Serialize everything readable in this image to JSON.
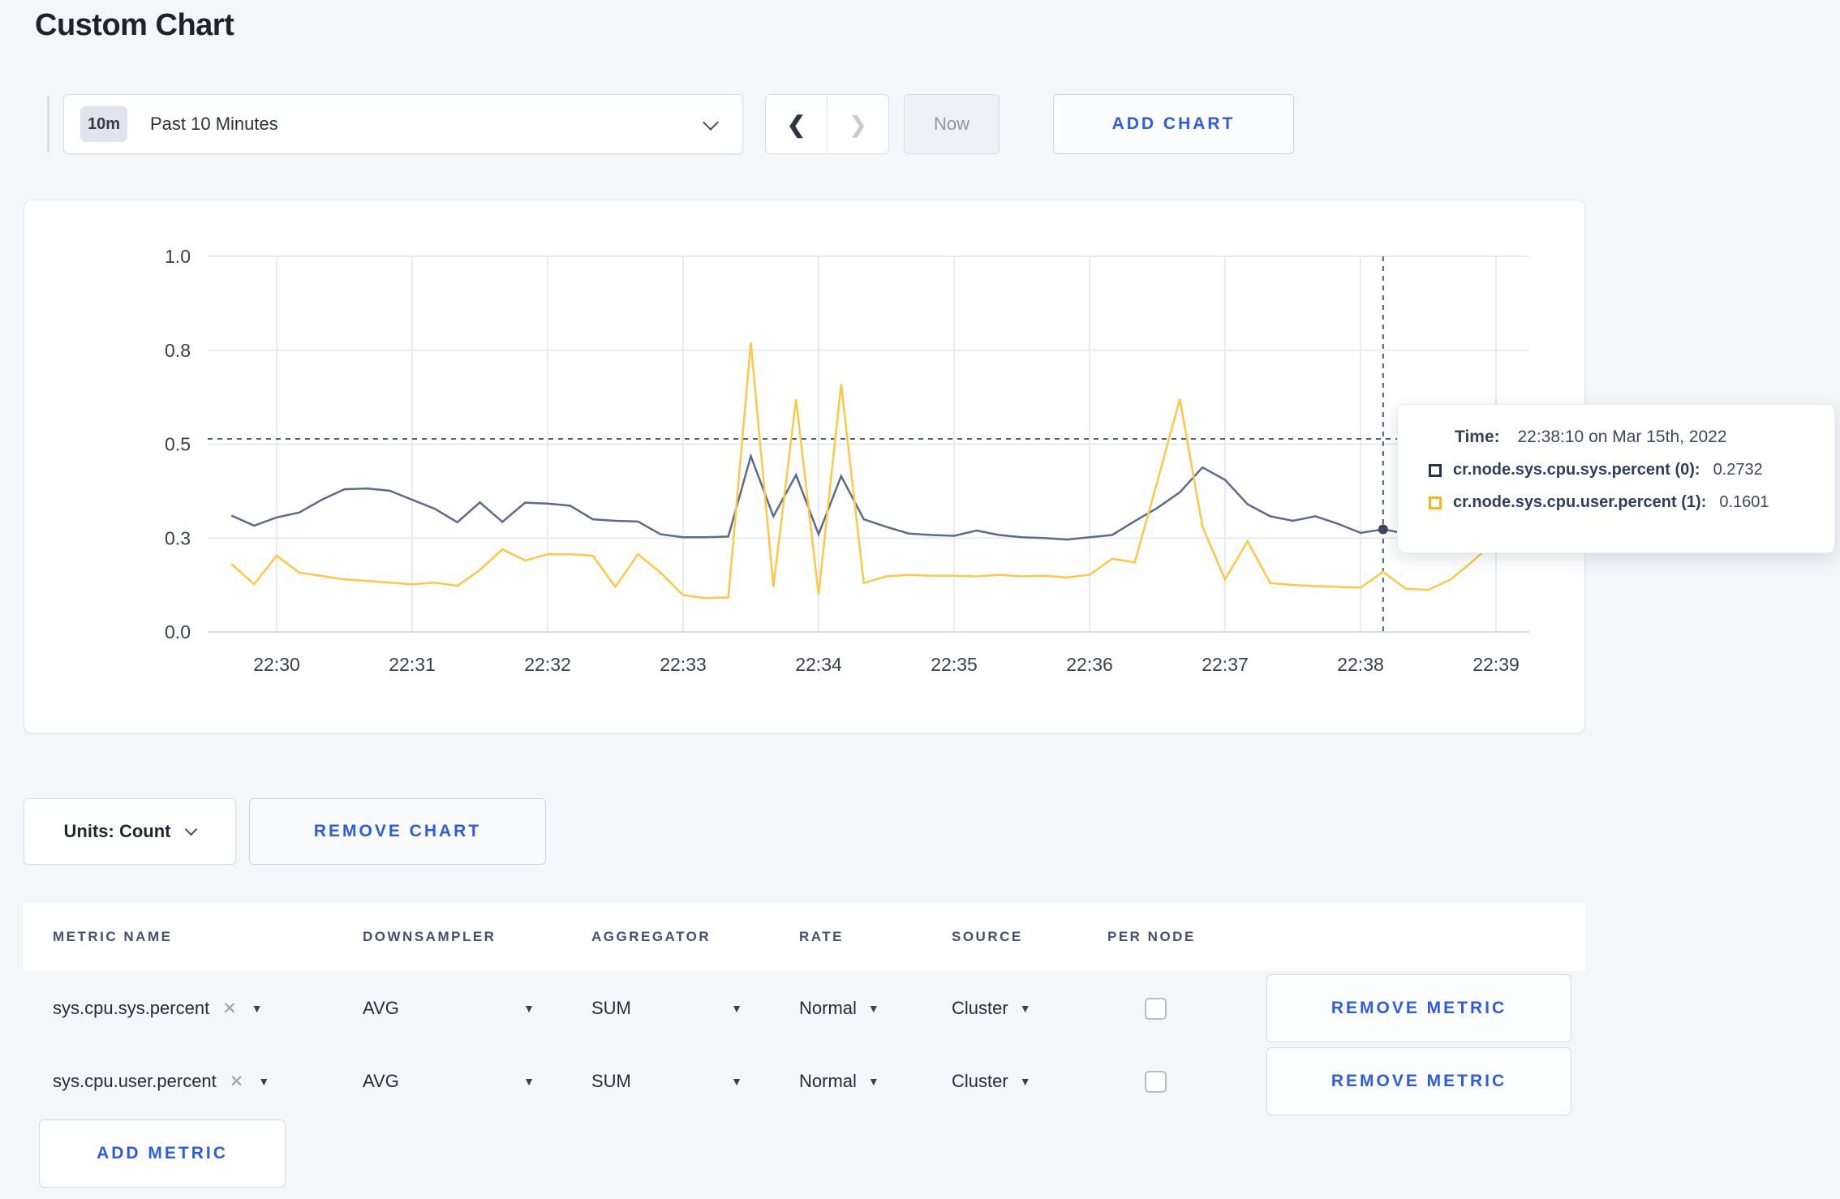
{
  "page": {
    "title": "Custom Chart"
  },
  "toolbar": {
    "time_range": {
      "badge": "10m",
      "label": "Past 10 Minutes"
    },
    "prev_label": "❮",
    "next_label": "❯",
    "now_label": "Now",
    "add_chart_label": "ADD CHART"
  },
  "chart_data": {
    "type": "line",
    "title": "",
    "xlabel": "",
    "ylabel": "",
    "ylim": [
      0,
      1
    ],
    "grid": true,
    "legend_position": "none",
    "y_ticks": [
      {
        "value": 0,
        "label": "0.0"
      },
      {
        "value": 0.25,
        "label": "0.3"
      },
      {
        "value": 0.5,
        "label": "0.5"
      },
      {
        "value": 0.75,
        "label": "0.8"
      },
      {
        "value": 1,
        "label": "1.0"
      }
    ],
    "x_ticks": [
      "22:30",
      "22:31",
      "22:32",
      "22:33",
      "22:34",
      "22:35",
      "22:36",
      "22:37",
      "22:38",
      "22:39"
    ],
    "times": [
      "22:29:40",
      "22:29:50",
      "22:30:00",
      "22:30:10",
      "22:30:20",
      "22:30:30",
      "22:30:40",
      "22:30:50",
      "22:31:00",
      "22:31:10",
      "22:31:20",
      "22:31:30",
      "22:31:40",
      "22:31:50",
      "22:32:00",
      "22:32:10",
      "22:32:20",
      "22:32:30",
      "22:32:40",
      "22:32:50",
      "22:33:00",
      "22:33:10",
      "22:33:20",
      "22:33:30",
      "22:33:40",
      "22:33:50",
      "22:34:00",
      "22:34:10",
      "22:34:20",
      "22:34:30",
      "22:34:40",
      "22:34:50",
      "22:35:00",
      "22:35:10",
      "22:35:20",
      "22:35:30",
      "22:35:40",
      "22:35:50",
      "22:36:00",
      "22:36:10",
      "22:36:20",
      "22:36:30",
      "22:36:40",
      "22:36:50",
      "22:37:00",
      "22:37:10",
      "22:37:20",
      "22:37:30",
      "22:37:40",
      "22:37:50",
      "22:38:00",
      "22:38:10",
      "22:38:20",
      "22:38:30",
      "22:38:40",
      "22:38:50",
      "22:39:00",
      "22:39:10"
    ],
    "series": [
      {
        "name": "cr.node.sys.cpu.sys.percent (0)",
        "color": "#5b6b8c",
        "values": [
          0.31,
          0.283,
          0.305,
          0.318,
          0.352,
          0.38,
          0.382,
          0.376,
          0.352,
          0.328,
          0.292,
          0.345,
          0.293,
          0.344,
          0.342,
          0.336,
          0.3,
          0.296,
          0.294,
          0.26,
          0.252,
          0.252,
          0.254,
          0.468,
          0.308,
          0.418,
          0.26,
          0.415,
          0.3,
          0.28,
          0.262,
          0.258,
          0.256,
          0.27,
          0.258,
          0.252,
          0.25,
          0.246,
          0.252,
          0.258,
          0.295,
          0.33,
          0.372,
          0.438,
          0.405,
          0.34,
          0.308,
          0.296,
          0.308,
          0.288,
          0.264,
          0.2732,
          0.262,
          0.27,
          0.296,
          0.27,
          0.262,
          0.27
        ]
      },
      {
        "name": "cr.node.sys.cpu.user.percent (1)",
        "color": "#fcc845",
        "values": [
          0.181,
          0.127,
          0.203,
          0.158,
          0.149,
          0.14,
          0.136,
          0.131,
          0.127,
          0.131,
          0.123,
          0.165,
          0.22,
          0.19,
          0.207,
          0.207,
          0.203,
          0.12,
          0.207,
          0.158,
          0.098,
          0.09,
          0.092,
          0.77,
          0.12,
          0.62,
          0.1,
          0.66,
          0.13,
          0.148,
          0.152,
          0.15,
          0.15,
          0.148,
          0.152,
          0.148,
          0.15,
          0.145,
          0.152,
          0.195,
          0.185,
          0.4,
          0.62,
          0.28,
          0.14,
          0.242,
          0.13,
          0.125,
          0.122,
          0.12,
          0.118,
          0.1601,
          0.115,
          0.112,
          0.14,
          0.19,
          0.245,
          0.225
        ]
      }
    ],
    "crosshair": {
      "time": "22:38:10",
      "x_index": 51,
      "hline_value": 0.514,
      "marker_series_index": 0,
      "marker_value": 0.2732
    }
  },
  "tooltip": {
    "time_label": "Time:",
    "time_value": "22:38:10 on Mar 15th, 2022",
    "rows": [
      {
        "label": "cr.node.sys.cpu.sys.percent (0):",
        "value": "0.2732",
        "color": "#24324d"
      },
      {
        "label": "cr.node.sys.cpu.user.percent (1):",
        "value": "0.1601",
        "color": "#fdb515"
      }
    ]
  },
  "chart_footer": {
    "units_label": "Units: Count",
    "remove_chart_label": "REMOVE CHART"
  },
  "metrics_table": {
    "headers": [
      "METRIC NAME",
      "DOWNSAMPLER",
      "AGGREGATOR",
      "RATE",
      "SOURCE",
      "PER NODE"
    ],
    "clear_glyph": "✕",
    "caret_glyph": "▼",
    "rows": [
      {
        "metric_name": "sys.cpu.sys.percent",
        "downsampler": "AVG",
        "aggregator": "SUM",
        "rate": "Normal",
        "source": "Cluster",
        "per_node_checked": false,
        "remove_label": "REMOVE METRIC"
      },
      {
        "metric_name": "sys.cpu.user.percent",
        "downsampler": "AVG",
        "aggregator": "SUM",
        "rate": "Normal",
        "source": "Cluster",
        "per_node_checked": false,
        "remove_label": "REMOVE METRIC"
      }
    ],
    "add_metric_label": "ADD METRIC"
  }
}
